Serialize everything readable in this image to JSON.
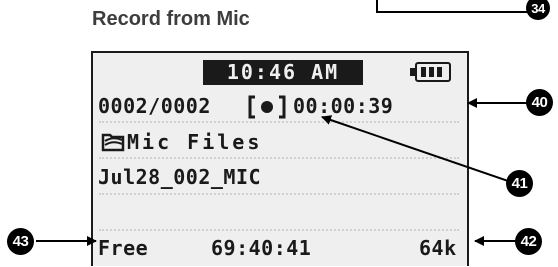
{
  "heading": "Record from Mic",
  "callouts": {
    "top": "34",
    "counter": "40",
    "mic": "41",
    "bitrate": "42",
    "free": "43"
  },
  "status": {
    "time": "10:46 AM",
    "battery": "battery-full-icon"
  },
  "recording": {
    "counter": "0002/0002",
    "elapsed": "00:00:39",
    "icon": "record-indicator-icon"
  },
  "folder": {
    "icon": "folder-icon",
    "name": "Mic Files"
  },
  "file": {
    "name": "Jul28_002_MIC"
  },
  "footer": {
    "free_label": "Free",
    "free_time": "69:40:41",
    "bitrate": "64k"
  }
}
